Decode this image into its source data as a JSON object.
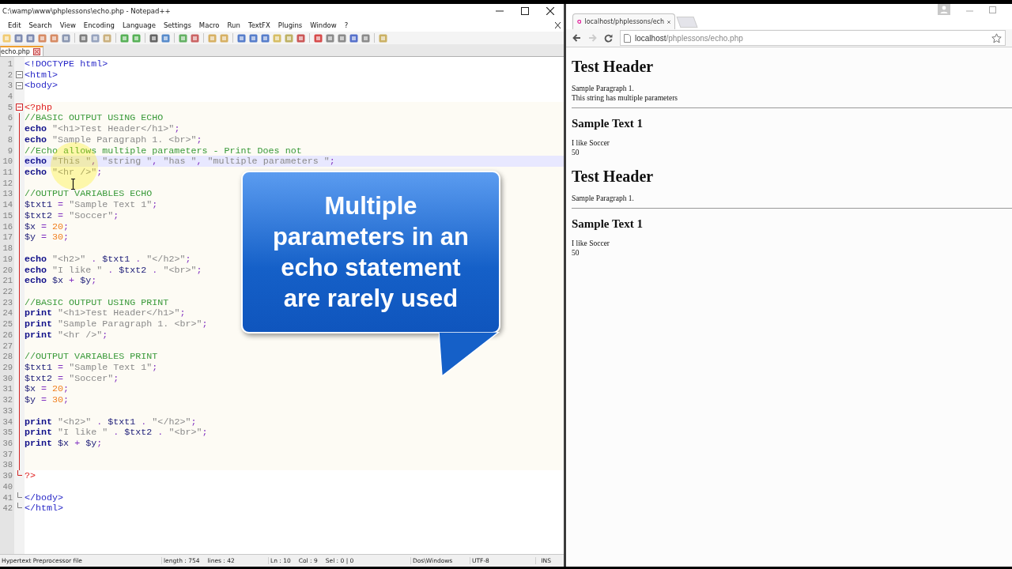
{
  "editor": {
    "title": "C:\\wamp\\www\\phplessons\\echo.php - Notepad++",
    "menu": [
      "Edit",
      "Search",
      "View",
      "Encoding",
      "Language",
      "Settings",
      "Macro",
      "Run",
      "TextFX",
      "Plugins",
      "Window",
      "?"
    ],
    "tabs": [
      {
        "label": "echo.php",
        "selected": true
      }
    ],
    "lines": [
      {
        "n": "1",
        "kind": "plain",
        "current": false,
        "php": false,
        "t": [
          {
            "kind": "tag",
            "text": "<!DOCTYPE html>"
          }
        ]
      },
      {
        "n": "2",
        "kind": "opener",
        "current": false,
        "php": false,
        "t": [
          {
            "kind": "tag",
            "text": "<html>"
          }
        ]
      },
      {
        "n": "3",
        "kind": "opener",
        "current": false,
        "php": false,
        "t": [
          {
            "kind": "tag",
            "text": "<body>"
          }
        ]
      },
      {
        "n": "4",
        "kind": "plain",
        "current": false,
        "php": false
      },
      {
        "n": "5",
        "kind": "opener",
        "current": false,
        "php": true,
        "t": [
          {
            "kind": "php",
            "text": "<?php"
          }
        ]
      },
      {
        "n": "6",
        "kind": "plain",
        "current": false,
        "php": true,
        "t": [
          {
            "kind": "com",
            "text": "//BASIC OUTPUT USING ECHO"
          }
        ]
      },
      {
        "n": "7",
        "kind": "plain",
        "current": false,
        "php": true,
        "t": [
          {
            "kind": "kw",
            "text": "echo "
          },
          {
            "kind": "str",
            "text": "\"<h1>Test Header</h1>\""
          },
          {
            "kind": "op",
            "text": ";"
          }
        ]
      },
      {
        "n": "8",
        "kind": "plain",
        "current": false,
        "php": true,
        "t": [
          {
            "kind": "kw",
            "text": "echo "
          },
          {
            "kind": "str",
            "text": "\"Sample Paragraph 1. <br>\""
          },
          {
            "kind": "op",
            "text": ";"
          }
        ]
      },
      {
        "n": "9",
        "kind": "plain",
        "current": false,
        "php": true,
        "t": [
          {
            "kind": "com",
            "text": "//Echo allows multiple parameters - Print Does not"
          }
        ]
      },
      {
        "n": "10",
        "kind": "plain",
        "current": true,
        "php": true,
        "t": [
          {
            "kind": "kw",
            "text": "echo "
          },
          {
            "kind": "str",
            "text": "\"This \""
          },
          {
            "kind": "op",
            "text": ", "
          },
          {
            "kind": "str",
            "text": "\"string \""
          },
          {
            "kind": "op",
            "text": ", "
          },
          {
            "kind": "str",
            "text": "\"has \""
          },
          {
            "kind": "op",
            "text": ", "
          },
          {
            "kind": "str",
            "text": "\"multiple parameters \""
          },
          {
            "kind": "op",
            "text": ";"
          }
        ]
      },
      {
        "n": "11",
        "kind": "plain",
        "current": false,
        "php": true,
        "t": [
          {
            "kind": "kw",
            "text": "echo "
          },
          {
            "kind": "str",
            "text": "\"<hr />\""
          },
          {
            "kind": "op",
            "text": ";"
          }
        ]
      },
      {
        "n": "12",
        "kind": "plain",
        "current": false,
        "php": true
      },
      {
        "n": "13",
        "kind": "plain",
        "current": false,
        "php": true,
        "t": [
          {
            "kind": "com",
            "text": "//OUTPUT VARIABLES ECHO"
          }
        ]
      },
      {
        "n": "14",
        "kind": "plain",
        "current": false,
        "php": true,
        "t": [
          {
            "kind": "var",
            "text": "$txt1"
          },
          {
            "kind": "op",
            "text": " = "
          },
          {
            "kind": "str",
            "text": "\"Sample Text 1\""
          },
          {
            "kind": "op",
            "text": ";"
          }
        ]
      },
      {
        "n": "15",
        "kind": "plain",
        "current": false,
        "php": true,
        "t": [
          {
            "kind": "var",
            "text": "$txt2"
          },
          {
            "kind": "op",
            "text": " = "
          },
          {
            "kind": "str",
            "text": "\"Soccer\""
          },
          {
            "kind": "op",
            "text": ";"
          }
        ]
      },
      {
        "n": "16",
        "kind": "plain",
        "current": false,
        "php": true,
        "t": [
          {
            "kind": "var",
            "text": "$x"
          },
          {
            "kind": "op",
            "text": " = "
          },
          {
            "kind": "num",
            "text": "20"
          },
          {
            "kind": "op",
            "text": ";"
          }
        ]
      },
      {
        "n": "17",
        "kind": "plain",
        "current": false,
        "php": true,
        "t": [
          {
            "kind": "var",
            "text": "$y"
          },
          {
            "kind": "op",
            "text": " = "
          },
          {
            "kind": "num",
            "text": "30"
          },
          {
            "kind": "op",
            "text": ";"
          }
        ]
      },
      {
        "n": "18",
        "kind": "plain",
        "current": false,
        "php": true
      },
      {
        "n": "19",
        "kind": "plain",
        "current": false,
        "php": true,
        "t": [
          {
            "kind": "kw",
            "text": "echo "
          },
          {
            "kind": "str",
            "text": "\"<h2>\""
          },
          {
            "kind": "op",
            "text": " . "
          },
          {
            "kind": "var",
            "text": "$txt1"
          },
          {
            "kind": "op",
            "text": " . "
          },
          {
            "kind": "str",
            "text": "\"</h2>\""
          },
          {
            "kind": "op",
            "text": ";"
          }
        ]
      },
      {
        "n": "20",
        "kind": "plain",
        "current": false,
        "php": true,
        "t": [
          {
            "kind": "kw",
            "text": "echo "
          },
          {
            "kind": "str",
            "text": "\"I like \""
          },
          {
            "kind": "op",
            "text": " . "
          },
          {
            "kind": "var",
            "text": "$txt2"
          },
          {
            "kind": "op",
            "text": " . "
          },
          {
            "kind": "str",
            "text": "\"<br>\""
          },
          {
            "kind": "op",
            "text": ";"
          }
        ]
      },
      {
        "n": "21",
        "kind": "plain",
        "current": false,
        "php": true,
        "t": [
          {
            "kind": "kw",
            "text": "echo "
          },
          {
            "kind": "var",
            "text": "$x"
          },
          {
            "kind": "op",
            "text": " + "
          },
          {
            "kind": "var",
            "text": "$y"
          },
          {
            "kind": "op",
            "text": ";"
          }
        ]
      },
      {
        "n": "22",
        "kind": "plain",
        "current": false,
        "php": true
      },
      {
        "n": "23",
        "kind": "plain",
        "current": false,
        "php": true,
        "t": [
          {
            "kind": "com",
            "text": "//BASIC OUTPUT USING PRINT"
          }
        ]
      },
      {
        "n": "24",
        "kind": "plain",
        "current": false,
        "php": true,
        "t": [
          {
            "kind": "kw",
            "text": "print "
          },
          {
            "kind": "str",
            "text": "\"<h1>Test Header</h1>\""
          },
          {
            "kind": "op",
            "text": ";"
          }
        ]
      },
      {
        "n": "25",
        "kind": "plain",
        "current": false,
        "php": true,
        "t": [
          {
            "kind": "kw",
            "text": "print "
          },
          {
            "kind": "str",
            "text": "\"Sample Paragraph 1. <br>\""
          },
          {
            "kind": "op",
            "text": ";"
          }
        ]
      },
      {
        "n": "26",
        "kind": "plain",
        "current": false,
        "php": true,
        "t": [
          {
            "kind": "kw",
            "text": "print "
          },
          {
            "kind": "str",
            "text": "\"<hr />\""
          },
          {
            "kind": "op",
            "text": ";"
          }
        ]
      },
      {
        "n": "27",
        "kind": "plain",
        "current": false,
        "php": true
      },
      {
        "n": "28",
        "kind": "plain",
        "current": false,
        "php": true,
        "t": [
          {
            "kind": "com",
            "text": "//OUTPUT VARIABLES PRINT"
          }
        ]
      },
      {
        "n": "29",
        "kind": "plain",
        "current": false,
        "php": true,
        "t": [
          {
            "kind": "var",
            "text": "$txt1"
          },
          {
            "kind": "op",
            "text": " = "
          },
          {
            "kind": "str",
            "text": "\"Sample Text 1\""
          },
          {
            "kind": "op",
            "text": ";"
          }
        ]
      },
      {
        "n": "30",
        "kind": "plain",
        "current": false,
        "php": true,
        "t": [
          {
            "kind": "var",
            "text": "$txt2"
          },
          {
            "kind": "op",
            "text": " = "
          },
          {
            "kind": "str",
            "text": "\"Soccer\""
          },
          {
            "kind": "op",
            "text": ";"
          }
        ]
      },
      {
        "n": "31",
        "kind": "plain",
        "current": false,
        "php": true,
        "t": [
          {
            "kind": "var",
            "text": "$x"
          },
          {
            "kind": "op",
            "text": " = "
          },
          {
            "kind": "num",
            "text": "20"
          },
          {
            "kind": "op",
            "text": ";"
          }
        ]
      },
      {
        "n": "32",
        "kind": "plain",
        "current": false,
        "php": true,
        "t": [
          {
            "kind": "var",
            "text": "$y"
          },
          {
            "kind": "op",
            "text": " = "
          },
          {
            "kind": "num",
            "text": "30"
          },
          {
            "kind": "op",
            "text": ";"
          }
        ]
      },
      {
        "n": "33",
        "kind": "plain",
        "current": false,
        "php": true
      },
      {
        "n": "34",
        "kind": "plain",
        "current": false,
        "php": true,
        "t": [
          {
            "kind": "kw",
            "text": "print "
          },
          {
            "kind": "str",
            "text": "\"<h2>\""
          },
          {
            "kind": "op",
            "text": " . "
          },
          {
            "kind": "var",
            "text": "$txt1"
          },
          {
            "kind": "op",
            "text": " . "
          },
          {
            "kind": "str",
            "text": "\"</h2>\""
          },
          {
            "kind": "op",
            "text": ";"
          }
        ]
      },
      {
        "n": "35",
        "kind": "plain",
        "current": false,
        "php": true,
        "t": [
          {
            "kind": "kw",
            "text": "print "
          },
          {
            "kind": "str",
            "text": "\"I like \""
          },
          {
            "kind": "op",
            "text": " . "
          },
          {
            "kind": "var",
            "text": "$txt2"
          },
          {
            "kind": "op",
            "text": " . "
          },
          {
            "kind": "str",
            "text": "\"<br>\""
          },
          {
            "kind": "op",
            "text": ";"
          }
        ]
      },
      {
        "n": "36",
        "kind": "plain",
        "current": false,
        "php": true,
        "t": [
          {
            "kind": "kw",
            "text": "print "
          },
          {
            "kind": "var",
            "text": "$x"
          },
          {
            "kind": "op",
            "text": " + "
          },
          {
            "kind": "var",
            "text": "$y"
          },
          {
            "kind": "op",
            "text": ";"
          }
        ]
      },
      {
        "n": "37",
        "kind": "plain",
        "current": false,
        "php": true
      },
      {
        "n": "38",
        "kind": "plain",
        "current": false,
        "php": true
      },
      {
        "n": "39",
        "kind": "closer",
        "current": false,
        "php": false,
        "t": [
          {
            "kind": "php",
            "text": "?>"
          }
        ]
      },
      {
        "n": "40",
        "kind": "plain",
        "current": false,
        "php": false
      },
      {
        "n": "41",
        "kind": "closer",
        "current": false,
        "php": false,
        "t": [
          {
            "kind": "tag",
            "text": "</body>"
          }
        ]
      },
      {
        "n": "42",
        "kind": "closer",
        "current": false,
        "php": false,
        "t": [
          {
            "kind": "tag",
            "text": "</html>"
          }
        ]
      }
    ],
    "callout": "Multiple parameters in an echo statement are rarely used",
    "status_bar": [
      [
        "Hypertext Preprocessor file"
      ],
      [
        "length : 754",
        "lines : 42"
      ],
      [
        "Ln : 10",
        "Col : 9",
        "Sel : 0 | 0"
      ],
      [
        "Dos\\Windows"
      ],
      [
        "UTF-8"
      ],
      [
        "INS"
      ]
    ]
  },
  "browser": {
    "tabs": [
      {
        "label": "localhost/phplessons/ech",
        "selected": true
      }
    ],
    "url": {
      "host": "localhost",
      "path": "/phplessons/echo.php"
    },
    "content": [
      {
        "kind": "h1",
        "text": "Test Header"
      },
      {
        "kind": "text",
        "lines": [
          "Sample Paragraph 1.",
          "This string has multiple parameters"
        ]
      },
      {
        "kind": "hr"
      },
      {
        "kind": "h2",
        "text": "Sample Text 1"
      },
      {
        "kind": "text",
        "lines": [
          "I like Soccer",
          "50"
        ]
      },
      {
        "kind": "h1",
        "text": "Test Header"
      },
      {
        "kind": "text",
        "lines": [
          "Sample Paragraph 1."
        ]
      },
      {
        "kind": "hr"
      },
      {
        "kind": "h2",
        "text": "Sample Text 1"
      },
      {
        "kind": "text",
        "lines": [
          "I like Soccer",
          "50"
        ]
      }
    ]
  }
}
